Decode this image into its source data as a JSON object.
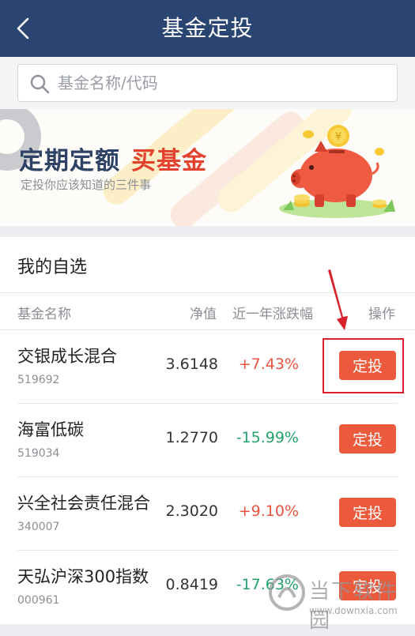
{
  "header": {
    "title": "基金定投",
    "back_icon": "back-chevron-icon"
  },
  "search": {
    "placeholder": "基金名称/代码",
    "icon": "search-icon"
  },
  "banner": {
    "title_part1": "定期定额",
    "title_part2": "买基金",
    "subtitle": "定投你应该知道的三件事",
    "illustration": "piggy-bank-coins-icon"
  },
  "watchlist": {
    "title": "我的自选",
    "columns": {
      "name": "基金名称",
      "nav": "净值",
      "change": "近一年涨跌幅",
      "action": "操作"
    },
    "rows": [
      {
        "name": "交银成长混合",
        "code": "519692",
        "nav": "3.6148",
        "change": "+7.43%",
        "action": "定投"
      },
      {
        "name": "海富低碳",
        "code": "519034",
        "nav": "1.2770",
        "change": "-15.99%",
        "action": "定投"
      },
      {
        "name": "兴全社会责任混合",
        "code": "340007",
        "nav": "2.3020",
        "change": "+9.10%",
        "action": "定投"
      },
      {
        "name": "天弘沪深300指数",
        "code": "000961",
        "nav": "0.8419",
        "change": "-17.63%",
        "action": "定投"
      }
    ]
  },
  "watermark": {
    "name": "当下软件园",
    "url": "www.downxia.com"
  },
  "colors": {
    "header_bg": "#2a4572",
    "button": "#ec5a3d",
    "positive": "#e8543f",
    "negative": "#23a26b",
    "annotation": "#d9212b"
  }
}
